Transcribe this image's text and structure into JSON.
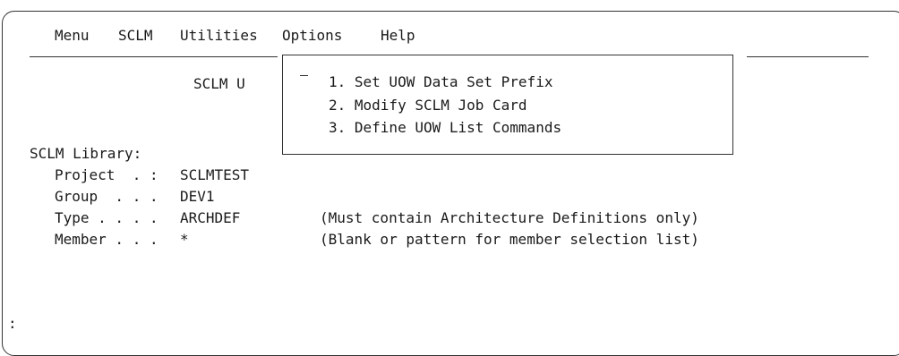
{
  "menu_bar": {
    "items": [
      "Menu",
      "SCLM",
      "Utilities",
      "Options",
      "Help"
    ]
  },
  "panel": {
    "title_fragment": "SCLM U",
    "library_label": "SCLM Library:",
    "fields": [
      {
        "label": "Project  . :",
        "value": "SCLMTEST",
        "note": ""
      },
      {
        "label": "Group  . . .",
        "value": "DEV1",
        "note": ""
      },
      {
        "label": "Type . . . .",
        "value": "ARCHDEF",
        "note": "(Must contain Architecture Definitions only)"
      },
      {
        "label": "Member . . .",
        "value": "*",
        "note": "(Blank or pattern for member selection list)"
      }
    ],
    "more_indicator": ":"
  },
  "options_popup": {
    "options": [
      "1. Set UOW Data Set Prefix",
      "2. Modify SCLM Job Card",
      "3. Define UOW List Commands"
    ]
  }
}
